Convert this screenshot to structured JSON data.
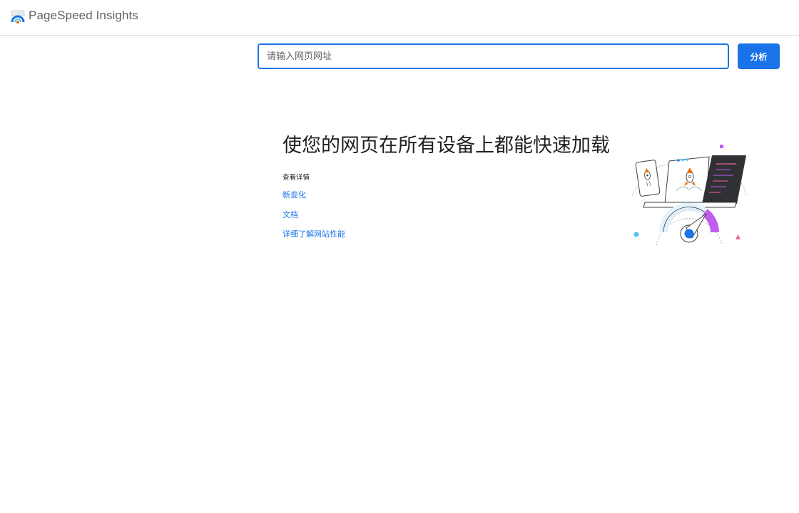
{
  "header": {
    "logo_icon": "pagespeed-gauge-icon",
    "brand": "PageSpeed Insights"
  },
  "search": {
    "placeholder": "请输入网页网址",
    "value": "",
    "button_label": "分析"
  },
  "main": {
    "headline": "使您的网页在所有设备上都能快速加载",
    "learn_more_label": "查看详情",
    "links": [
      {
        "label": "新变化"
      },
      {
        "label": "文档"
      },
      {
        "label": "详细了解网站性能"
      }
    ],
    "illustration_icon": "rocket-speed-illustration"
  },
  "colors": {
    "accent": "#1a73e8",
    "text": "#202124",
    "brand_text": "#5f6368",
    "divider": "#dadce0"
  }
}
